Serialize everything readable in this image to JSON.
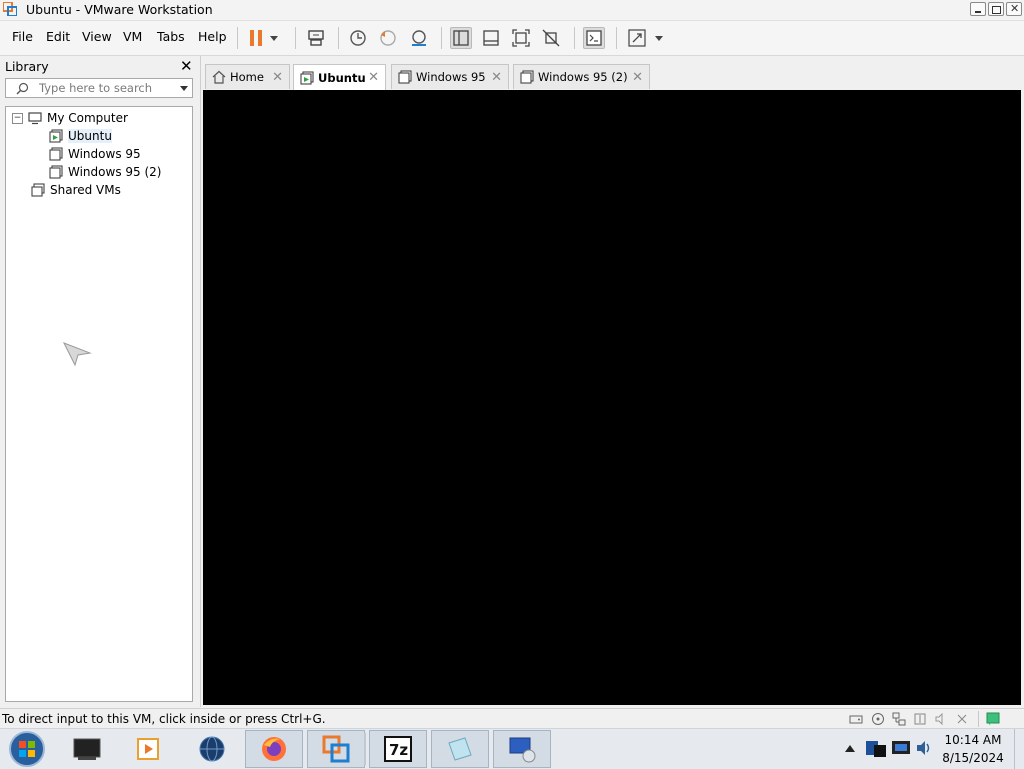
{
  "window": {
    "title": "Ubuntu - VMware Workstation"
  },
  "menubar": {
    "items": [
      "File",
      "Edit",
      "View",
      "VM",
      "Tabs",
      "Help"
    ]
  },
  "library": {
    "title": "Library",
    "search_placeholder": "Type here to search",
    "tree": {
      "root": "My Computer",
      "vms": [
        "Ubuntu",
        "Windows 95",
        "Windows 95 (2)"
      ],
      "selected": "Ubuntu",
      "shared": "Shared VMs"
    }
  },
  "tabs": [
    {
      "label": "Home",
      "active": false
    },
    {
      "label": "Ubuntu",
      "active": true
    },
    {
      "label": "Windows 95",
      "active": false
    },
    {
      "label": "Windows 95 (2)",
      "active": false
    }
  ],
  "statusbar": {
    "text": "To direct input to this VM, click inside or press Ctrl+G."
  },
  "taskbar": {
    "time": "10:14 AM",
    "date": "8/15/2024"
  },
  "colors": {
    "vm_screen": "#000000",
    "pause_orange": "#e8792f",
    "vmware_blue": "#1e7fd0",
    "selection": "#e5f0fb"
  }
}
